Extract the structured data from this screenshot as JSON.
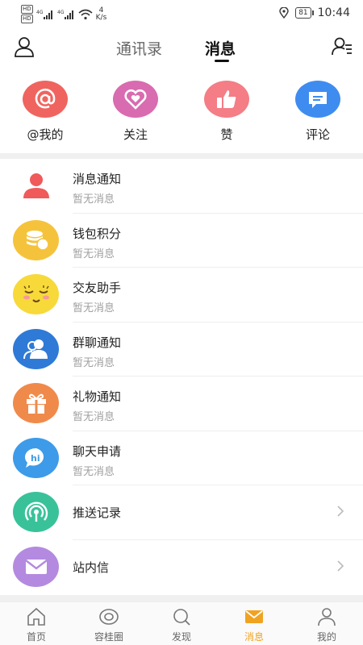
{
  "status_bar": {
    "hd1": "HD",
    "hd2": "HD",
    "net1": "4G",
    "net2": "4G",
    "speed_value": "4",
    "speed_unit": "K/s",
    "battery": "81",
    "time": "10:44"
  },
  "top_nav": {
    "tabs": [
      {
        "label": "通讯录",
        "active": false
      },
      {
        "label": "消息",
        "active": true
      }
    ]
  },
  "quick_actions": [
    {
      "label": "@我的",
      "icon": "at-icon",
      "color": "#f0645f"
    },
    {
      "label": "关注",
      "icon": "heart-icon",
      "color": "#d96bb0"
    },
    {
      "label": "赞",
      "icon": "thumbs-up-icon",
      "color": "#f47d86"
    },
    {
      "label": "评论",
      "icon": "comment-icon",
      "color": "#3f8cf0"
    }
  ],
  "messages": [
    {
      "title": "消息通知",
      "subtitle": "暂无消息",
      "icon": "person-icon",
      "color": "#f05a5a"
    },
    {
      "title": "钱包积分",
      "subtitle": "暂无消息",
      "icon": "coins-icon",
      "color": "#f5c33b"
    },
    {
      "title": "交友助手",
      "subtitle": "暂无消息",
      "icon": "smiley-icon",
      "color": "#f7d93a"
    },
    {
      "title": "群聊通知",
      "subtitle": "暂无消息",
      "icon": "group-icon",
      "color": "#2f7ad6"
    },
    {
      "title": "礼物通知",
      "subtitle": "暂无消息",
      "icon": "gift-icon",
      "color": "#f08a4b"
    },
    {
      "title": "聊天申请",
      "subtitle": "暂无消息",
      "icon": "hi-bubble-icon",
      "color": "#3d9be9"
    }
  ],
  "links": [
    {
      "title": "推送记录",
      "icon": "broadcast-icon",
      "color": "#39c29a"
    },
    {
      "title": "站内信",
      "icon": "envelope-icon",
      "color": "#b48ae0"
    }
  ],
  "bottom_nav": [
    {
      "label": "首页",
      "icon": "home-icon",
      "active": false
    },
    {
      "label": "容桂圈",
      "icon": "circle-icon",
      "active": false
    },
    {
      "label": "发现",
      "icon": "discover-icon",
      "active": false
    },
    {
      "label": "消息",
      "icon": "message-icon",
      "active": true
    },
    {
      "label": "我的",
      "icon": "profile-icon",
      "active": false
    }
  ],
  "colors": {
    "accent": "#f0a321",
    "active_tab": "#111111",
    "subtitle": "#a0a0a0"
  }
}
